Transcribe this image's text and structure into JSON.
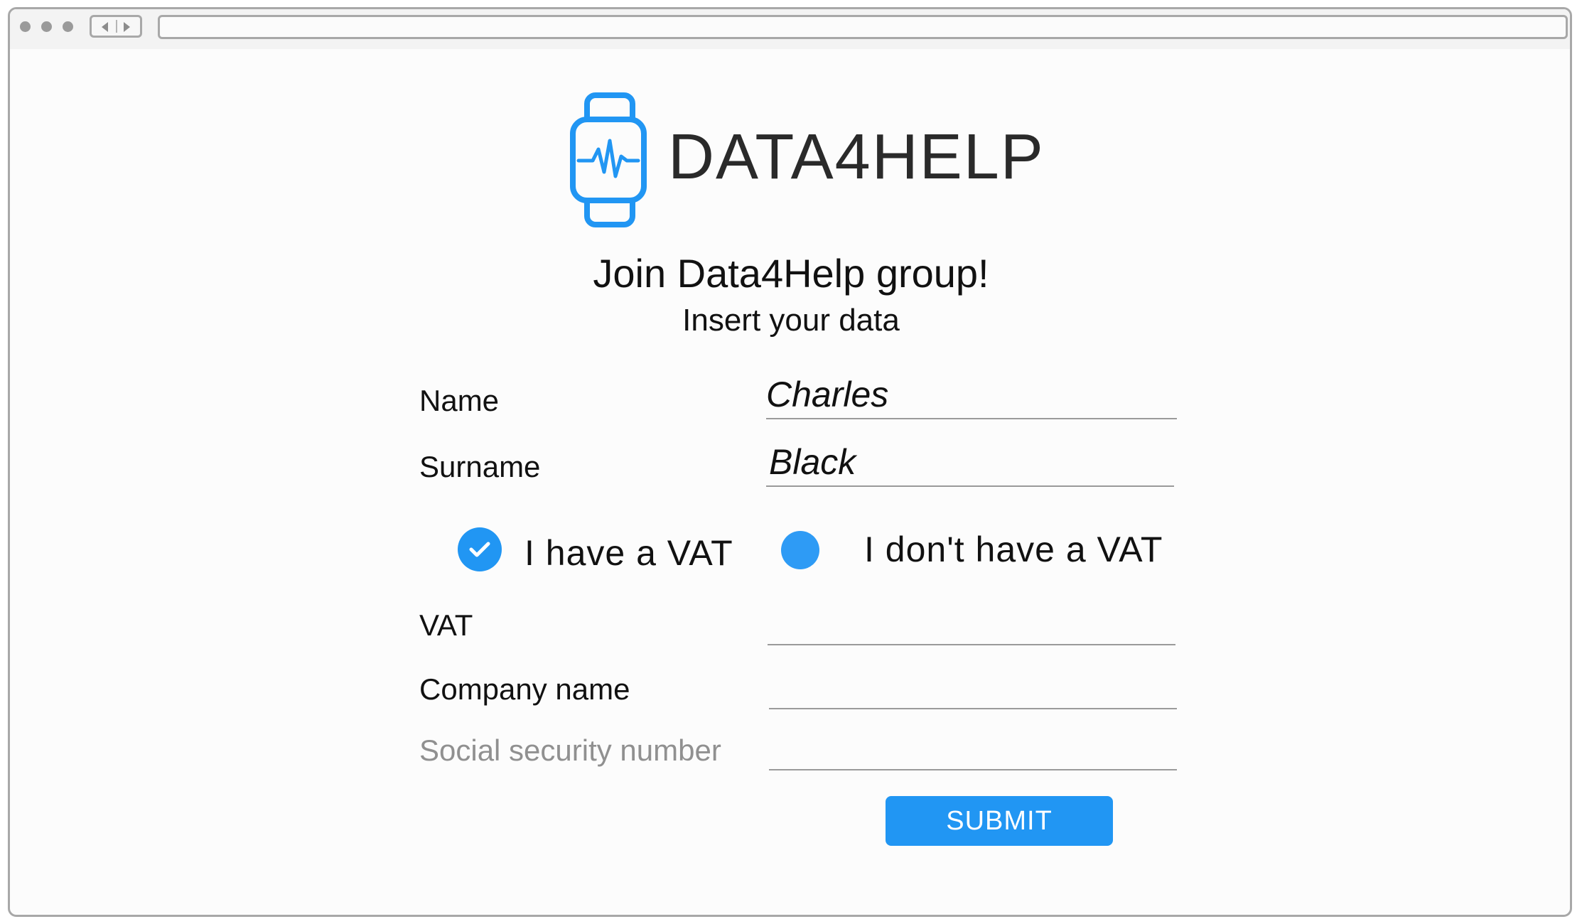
{
  "brand": {
    "name": "DATA4HELP",
    "accent_color": "#2196f3",
    "logo_icon": "smartwatch-heartbeat-icon"
  },
  "page": {
    "heading": "Join Data4Help group!",
    "subheading": "Insert your data"
  },
  "form": {
    "name": {
      "label": "Name",
      "value": "Charles"
    },
    "surname": {
      "label": "Surname",
      "value": "Black"
    },
    "vat_options": {
      "have_vat": {
        "label": "I have a VAT",
        "checked": true
      },
      "no_vat": {
        "label": "I don't have a VAT",
        "checked": false
      }
    },
    "vat": {
      "label": "VAT",
      "value": ""
    },
    "company_name": {
      "label": "Company name",
      "value": ""
    },
    "ssn": {
      "label": "Social security number",
      "value": ""
    },
    "submit_label": "SUBMIT"
  }
}
